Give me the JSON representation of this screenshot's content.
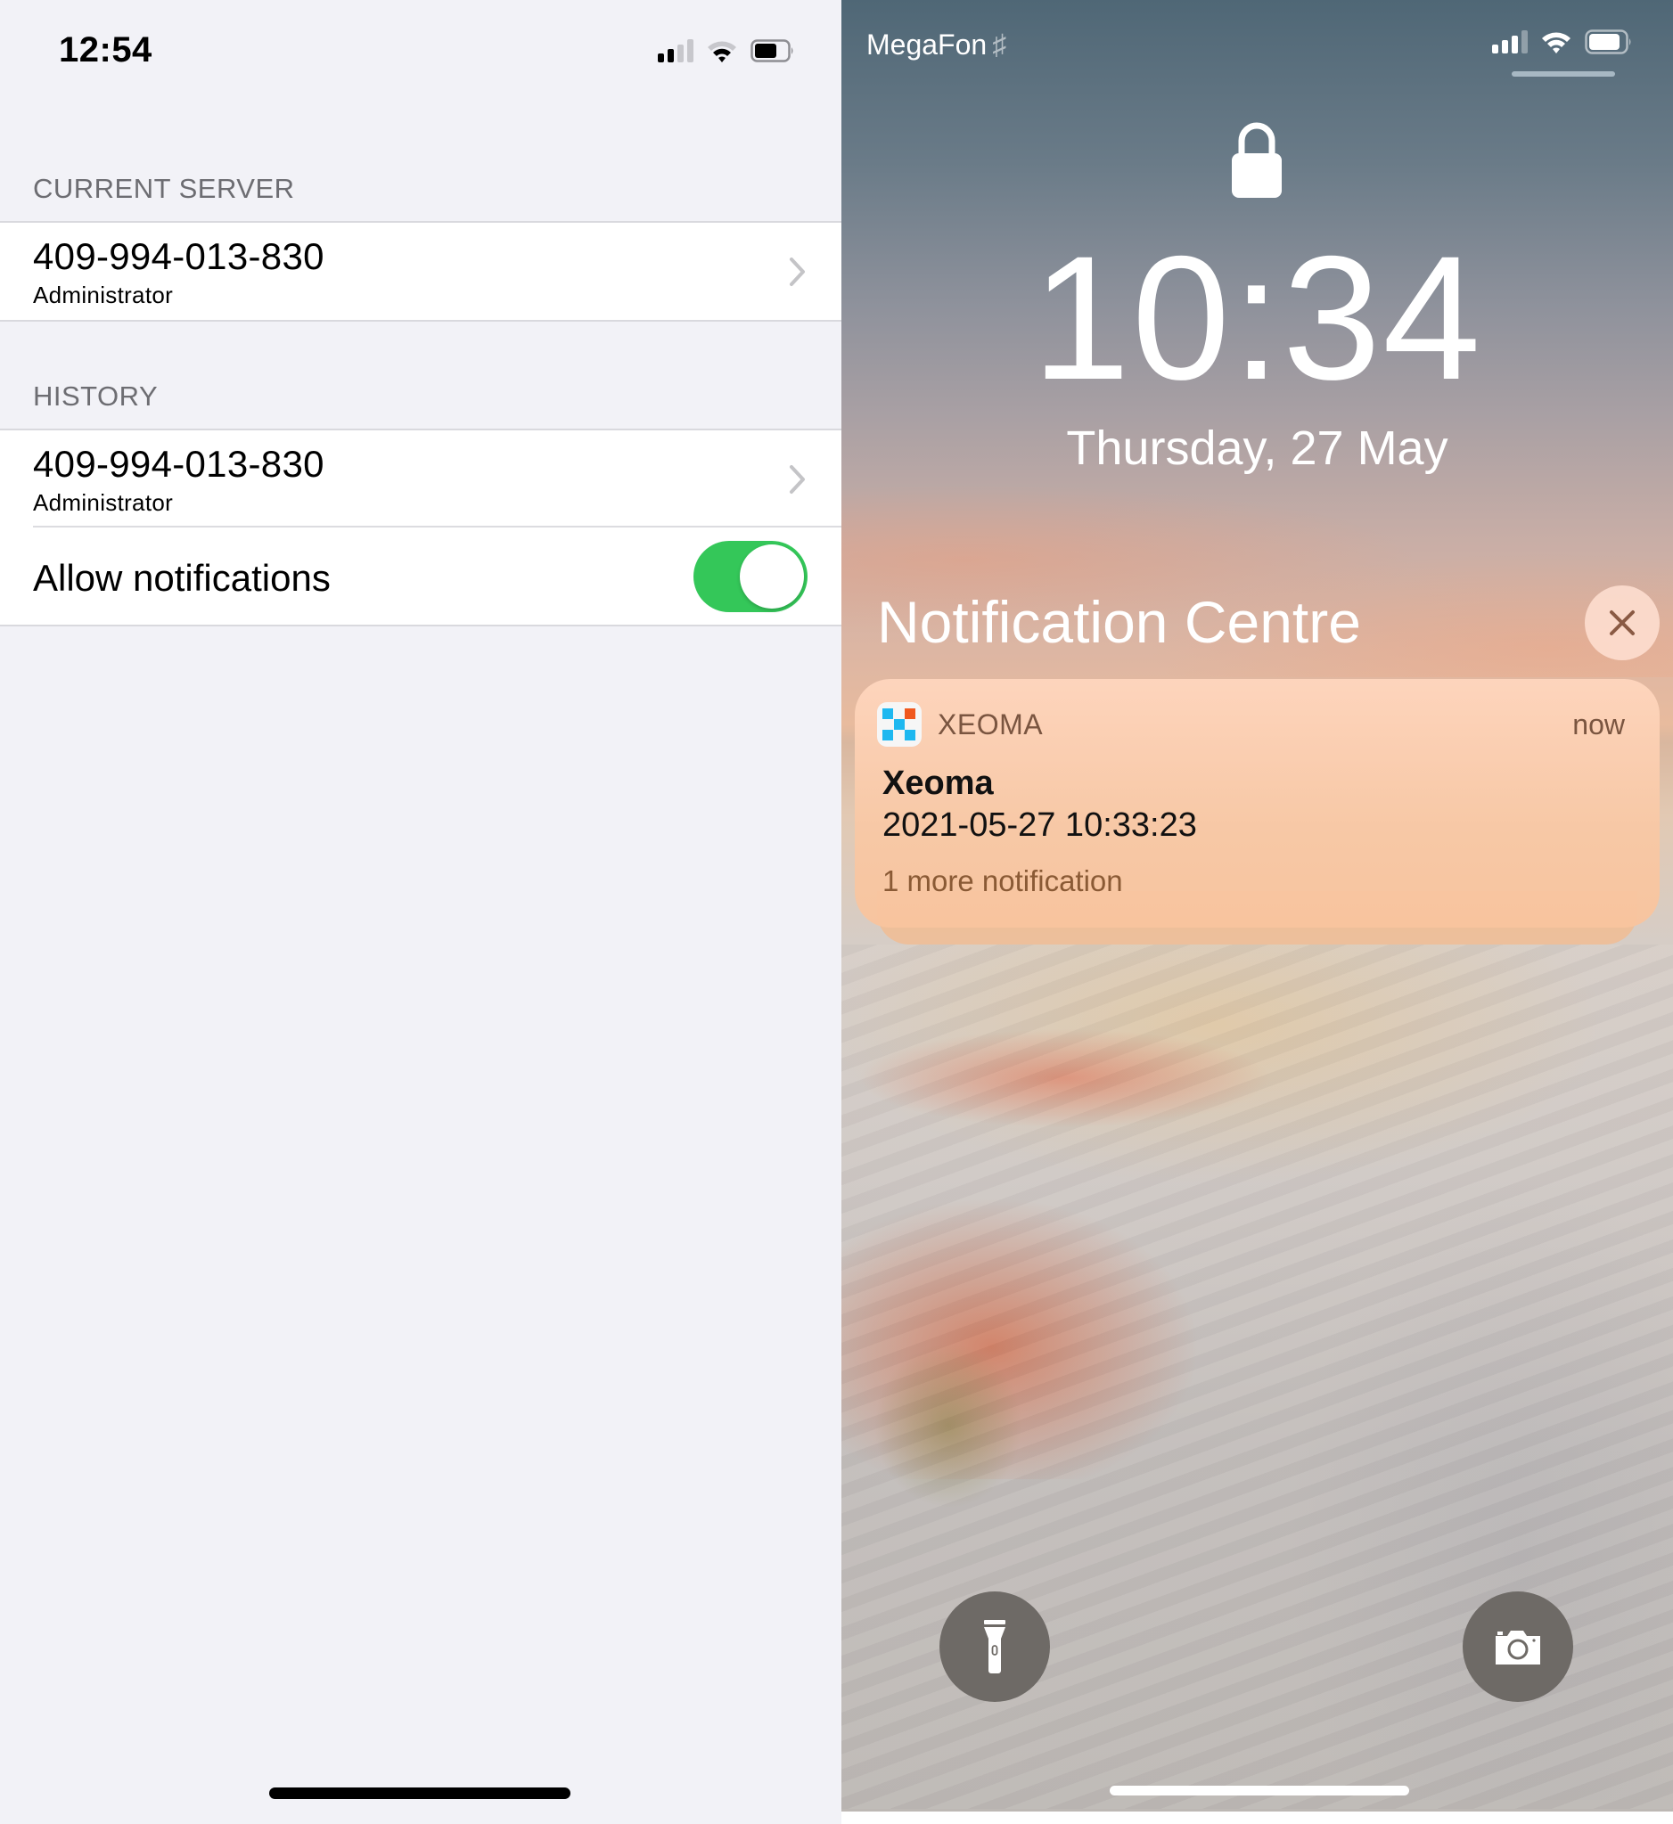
{
  "left_screen": {
    "status_bar": {
      "time": "12:54",
      "signal_bars_filled": 2,
      "signal_bars_total": 4,
      "wifi_arcs_filled": 2,
      "battery_level_percent": 60,
      "icons": [
        "signal-icon",
        "wifi-icon",
        "battery-icon"
      ]
    },
    "sections": {
      "current_server": {
        "header": "CURRENT SERVER",
        "rows": [
          {
            "title": "409-994-013-830",
            "subtitle": "Administrator",
            "accessory": "chevron-right-icon"
          }
        ]
      },
      "history": {
        "header": "HISTORY",
        "rows": [
          {
            "title": "409-994-013-830",
            "subtitle": "Administrator",
            "accessory": "chevron-right-icon"
          }
        ],
        "toggle": {
          "label": "Allow notifications",
          "on": true,
          "color": "#34C759"
        }
      }
    }
  },
  "right_screen": {
    "status_bar": {
      "carrier": "MegaFon",
      "carrier_suffix": "♯",
      "signal_bars_filled": 3,
      "signal_bars_total": 4,
      "wifi_arcs_filled": 3,
      "battery_level_percent": 80
    },
    "lock_icon": "lock-icon",
    "clock": "10:34",
    "date": "Thursday, 27 May",
    "notification_centre": {
      "title": "Notification Centre",
      "close_icon": "close-icon",
      "notification": {
        "app_name": "XEOMA",
        "time": "now",
        "title": "Xeoma",
        "body": "2021-05-27 10:33:23",
        "more": "1 more notification",
        "icon_colors": {
          "blue": "#1EB8F0",
          "orange": "#F0581E"
        }
      }
    },
    "quick_actions": [
      {
        "name": "flashlight",
        "icon": "flashlight-icon"
      },
      {
        "name": "camera",
        "icon": "camera-icon"
      }
    ]
  }
}
